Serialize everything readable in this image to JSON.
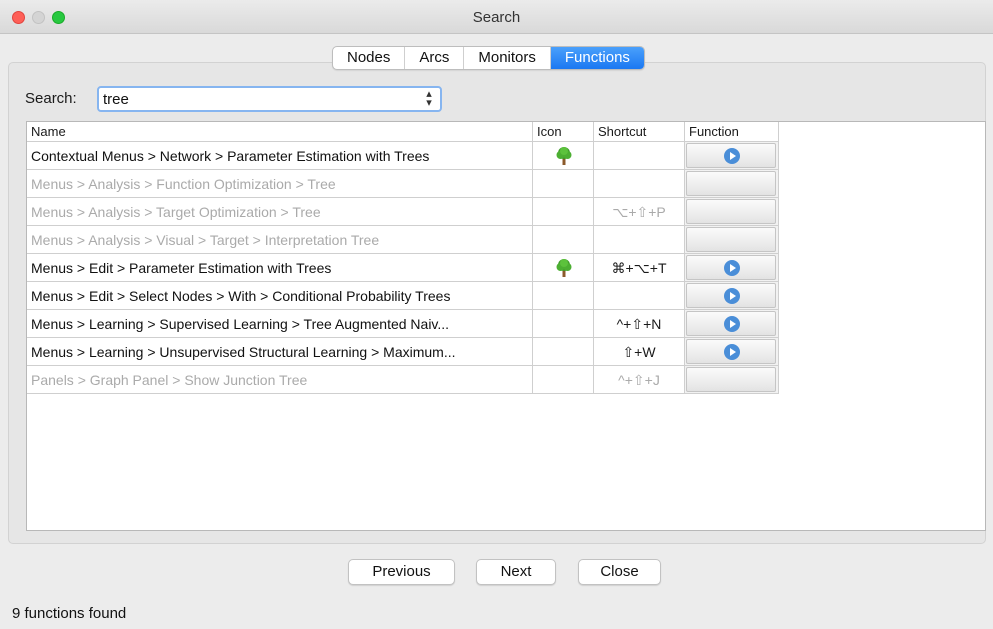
{
  "window": {
    "title": "Search"
  },
  "tabs": [
    {
      "label": "Nodes",
      "active": false
    },
    {
      "label": "Arcs",
      "active": false
    },
    {
      "label": "Monitors",
      "active": false
    },
    {
      "label": "Functions",
      "active": true
    }
  ],
  "search": {
    "label": "Search:",
    "value": "tree"
  },
  "table": {
    "columns": [
      "Name",
      "Icon",
      "Shortcut",
      "Function"
    ],
    "rows": [
      {
        "name": "Contextual Menus > Network > Parameter Estimation with Trees",
        "icon": "tree-icon",
        "shortcut": "",
        "enabled": true
      },
      {
        "name": "Menus > Analysis > Function Optimization > Tree",
        "icon": "",
        "shortcut": "",
        "enabled": false
      },
      {
        "name": "Menus > Analysis > Target Optimization > Tree",
        "icon": "",
        "shortcut": "⌥+⇧+P",
        "enabled": false
      },
      {
        "name": "Menus > Analysis > Visual > Target > Interpretation Tree",
        "icon": "",
        "shortcut": "",
        "enabled": false
      },
      {
        "name": "Menus > Edit > Parameter Estimation with Trees",
        "icon": "tree-icon",
        "shortcut": "⌘+⌥+T",
        "enabled": true
      },
      {
        "name": "Menus > Edit > Select Nodes > With > Conditional Probability Trees",
        "icon": "",
        "shortcut": "",
        "enabled": true
      },
      {
        "name": "Menus > Learning > Supervised Learning > Tree Augmented Naiv...",
        "icon": "",
        "shortcut": "^+⇧+N",
        "enabled": true
      },
      {
        "name": "Menus > Learning > Unsupervised Structural Learning > Maximum...",
        "icon": "",
        "shortcut": "⇧+W",
        "enabled": true
      },
      {
        "name": "Panels > Graph Panel > Show Junction Tree",
        "icon": "",
        "shortcut": "^+⇧+J",
        "enabled": false
      }
    ]
  },
  "buttons": {
    "previous": "Previous",
    "next": "Next",
    "close": "Close"
  },
  "status": "9 functions found",
  "colors": {
    "accent": "#1b78f2",
    "play": "#4a8ed8",
    "disabled_text": "#aaaaaa"
  }
}
